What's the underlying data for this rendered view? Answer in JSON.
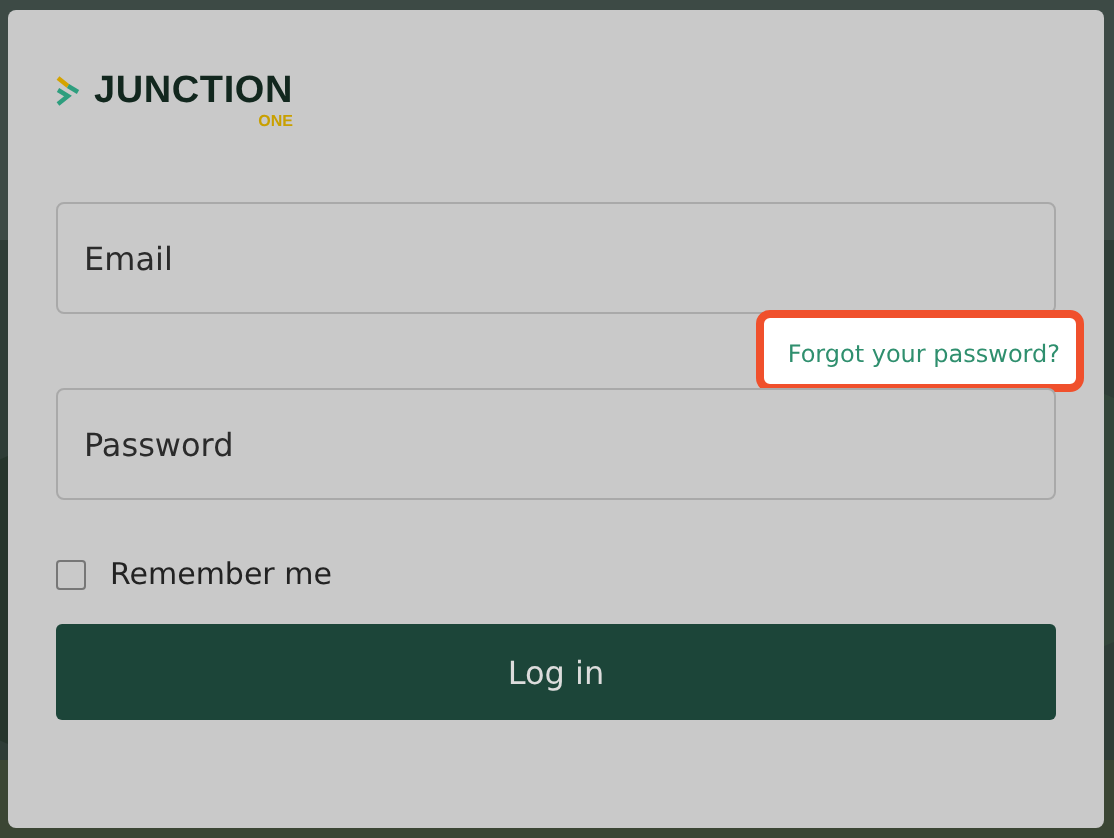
{
  "logo": {
    "name": "JUNCTION",
    "sub": "ONE"
  },
  "fields": [
    {
      "placeholder": "Email"
    },
    {
      "placeholder": "Password"
    }
  ],
  "forgot_password": {
    "label": "Forgot your password?",
    "highlighted": true
  },
  "remember": {
    "label": "Remember me",
    "checked": false
  },
  "login_button": {
    "label": "Log in"
  }
}
